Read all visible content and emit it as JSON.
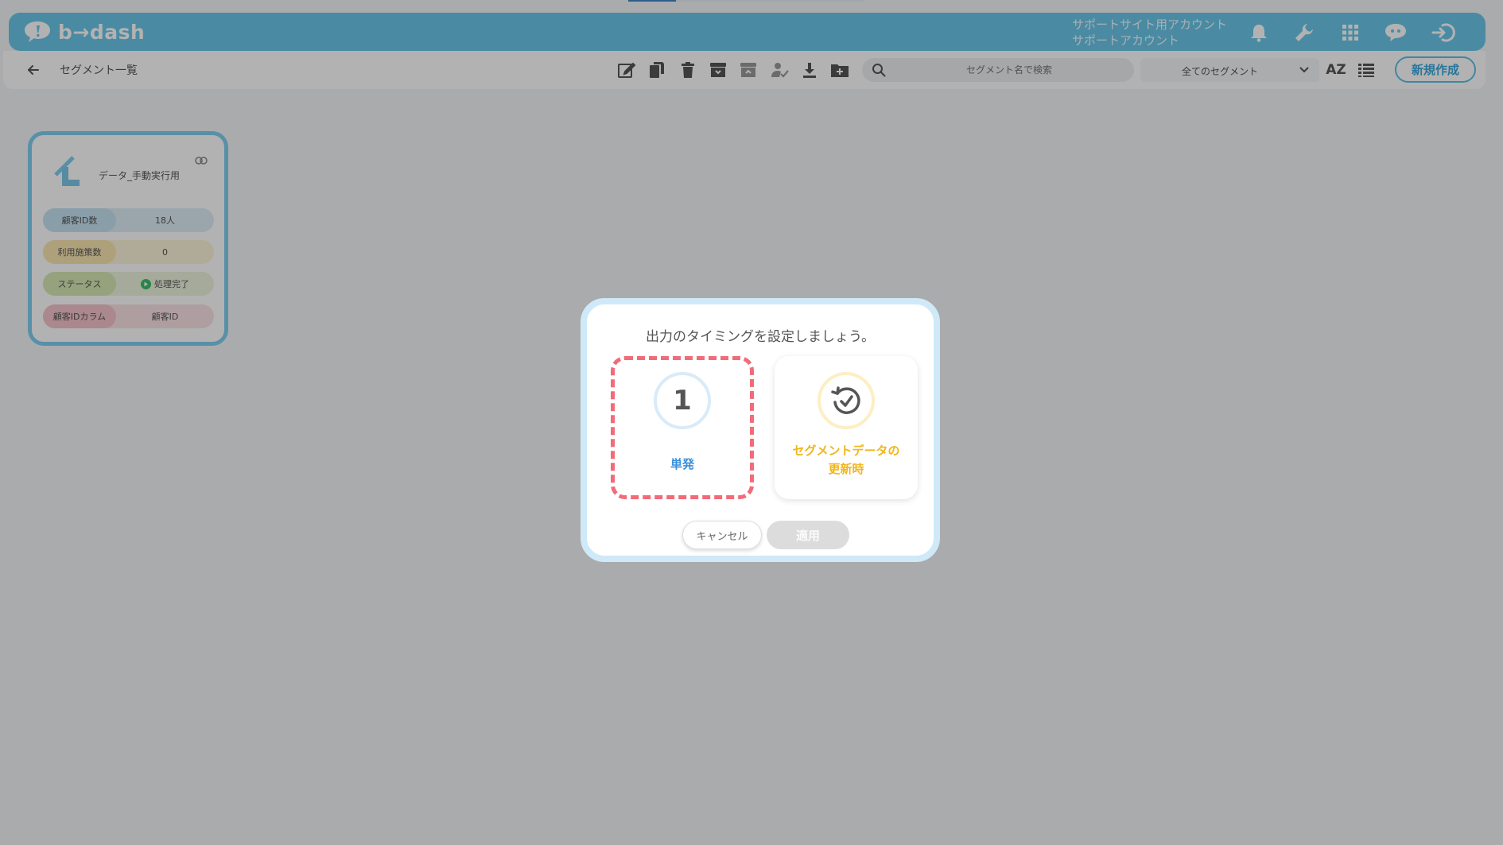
{
  "header": {
    "logo_text": "b→dash",
    "account_line1": "サポートサイト用アカウント",
    "account_line2": "サポートアカウント"
  },
  "toolbar": {
    "page_title": "セグメント一覧",
    "search": {
      "placeholder": "セグメント名で検索"
    },
    "segment_filter": {
      "selected": "全てのセグメント"
    },
    "sort_label": "AZ",
    "new_button": "新規作成"
  },
  "segment_card": {
    "name": "データ_手動実行用",
    "rows": [
      {
        "label": "顧客ID数",
        "value": "18人"
      },
      {
        "label": "利用施策数",
        "value": "0"
      },
      {
        "label": "ステータス",
        "value": "処理完了"
      },
      {
        "label": "顧客IDカラム",
        "value": "顧客ID"
      }
    ]
  },
  "modal": {
    "title": "出力のタイミングを設定しましょう。",
    "options": [
      {
        "number": "1",
        "label": "単発",
        "selected": true
      },
      {
        "label_line1": "セグメントデータの",
        "label_line2": "更新時",
        "selected": false
      }
    ],
    "cancel_label": "キャンセル",
    "apply_label": "適用"
  },
  "colors": {
    "header_bg": "#6ac7ea",
    "accent_blue": "#3a8fd9",
    "accent_yellow": "#f2b61a",
    "selected_outline": "#f26b79",
    "status_green": "#3cbf6a"
  }
}
